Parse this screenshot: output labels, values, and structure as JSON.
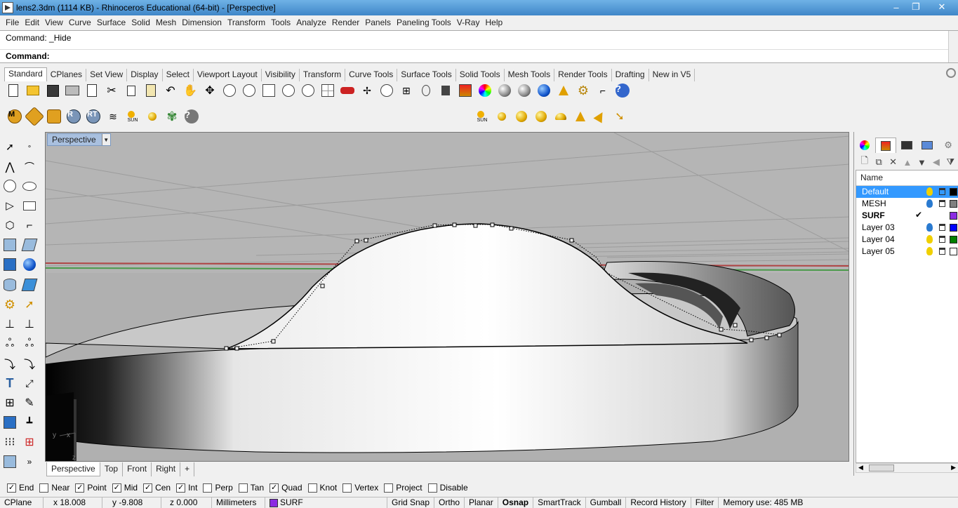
{
  "window": {
    "title": "lens2.3dm (1114 KB) - Rhinoceros Educational (64-bit) - [Perspective]",
    "minimize": "–",
    "maximize": "❐",
    "close": "✕"
  },
  "menu": [
    "File",
    "Edit",
    "View",
    "Curve",
    "Surface",
    "Solid",
    "Mesh",
    "Dimension",
    "Transform",
    "Tools",
    "Analyze",
    "Render",
    "Panels",
    "Paneling Tools",
    "V-Ray",
    "Help"
  ],
  "command": {
    "history": "Command: _Hide",
    "prompt_label": "Command:",
    "prompt_value": ""
  },
  "toolbar_tabs": [
    "Standard",
    "CPlanes",
    "Set View",
    "Display",
    "Select",
    "Viewport Layout",
    "Visibility",
    "Transform",
    "Curve Tools",
    "Surface Tools",
    "Solid Tools",
    "Mesh Tools",
    "Render Tools",
    "Drafting",
    "New in V5"
  ],
  "render_toolbar": {
    "m_label": "M",
    "r_label": "R",
    "rt_label": "RT",
    "sun_label": "SUN",
    "sun2_label": "SUN",
    "help_label": "?"
  },
  "standard_toolbar": {
    "help_label": "?"
  },
  "viewport": {
    "title": "Perspective",
    "axis_y": "y",
    "axis_x": "x",
    "axis_z": "z"
  },
  "viewport_tabs": [
    "Perspective",
    "Top",
    "Front",
    "Right"
  ],
  "viewport_tab_add": "+",
  "left_tools": {
    "more": "»"
  },
  "layers": {
    "header": "Name",
    "rows": [
      {
        "name": "Default",
        "selected": true,
        "current": false,
        "bulb": "#f0d000",
        "color": "#000000"
      },
      {
        "name": "MESH",
        "selected": false,
        "current": false,
        "bulb": "#2a7ad0",
        "color": "#808080"
      },
      {
        "name": "SURF",
        "selected": false,
        "current": true,
        "bulb": "",
        "color": "#8b2be2"
      },
      {
        "name": "Layer 03",
        "selected": false,
        "current": false,
        "bulb": "#2a7ad0",
        "color": "#0000ff"
      },
      {
        "name": "Layer 04",
        "selected": false,
        "current": false,
        "bulb": "#f0d000",
        "color": "#008000"
      },
      {
        "name": "Layer 05",
        "selected": false,
        "current": false,
        "bulb": "#f0d000",
        "color": "#ffffff"
      }
    ],
    "current_mark": "✔"
  },
  "osnaps": [
    {
      "label": "End",
      "checked": true
    },
    {
      "label": "Near",
      "checked": false
    },
    {
      "label": "Point",
      "checked": true
    },
    {
      "label": "Mid",
      "checked": true
    },
    {
      "label": "Cen",
      "checked": true
    },
    {
      "label": "Int",
      "checked": true
    },
    {
      "label": "Perp",
      "checked": false
    },
    {
      "label": "Tan",
      "checked": false
    },
    {
      "label": "Quad",
      "checked": true
    },
    {
      "label": "Knot",
      "checked": false
    },
    {
      "label": "Vertex",
      "checked": false
    },
    {
      "label": "Project",
      "checked": false
    },
    {
      "label": "Disable",
      "checked": false
    }
  ],
  "status": {
    "cplane": "CPlane",
    "x": "x 18.008",
    "y": "y -9.808",
    "z": "z 0.000",
    "units": "Millimeters",
    "layer": "SURF",
    "layer_color": "#8b2be2",
    "grid_snap": "Grid Snap",
    "ortho": "Ortho",
    "planar": "Planar",
    "osnap": "Osnap",
    "smarttrack": "SmartTrack",
    "gumball": "Gumball",
    "record_history": "Record History",
    "filter": "Filter",
    "memory": "Memory use: 485 MB"
  }
}
